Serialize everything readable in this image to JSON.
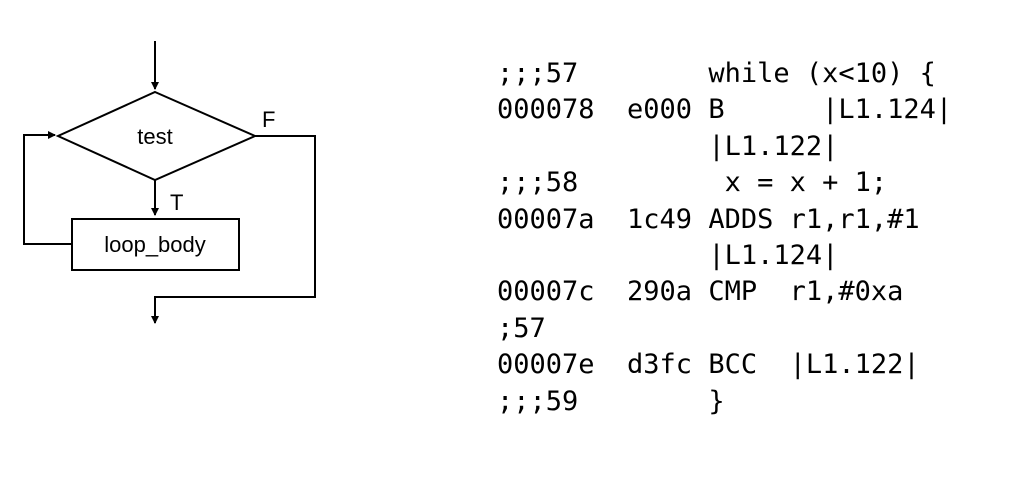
{
  "flowchart": {
    "decision_label": "test",
    "body_label": "loop_body",
    "true_label": "T",
    "false_label": "F"
  },
  "code": {
    "lines": [
      ";;;57        while (x<10) {",
      "000078  e000 B      |L1.124|",
      "             |L1.122|",
      ";;;58         x = x + 1;",
      "00007a  1c49 ADDS r1,r1,#1",
      "             |L1.124|",
      "00007c  290a CMP  r1,#0xa",
      ";57",
      "00007e  d3fc BCC  |L1.122|",
      ";;;59        }"
    ]
  }
}
